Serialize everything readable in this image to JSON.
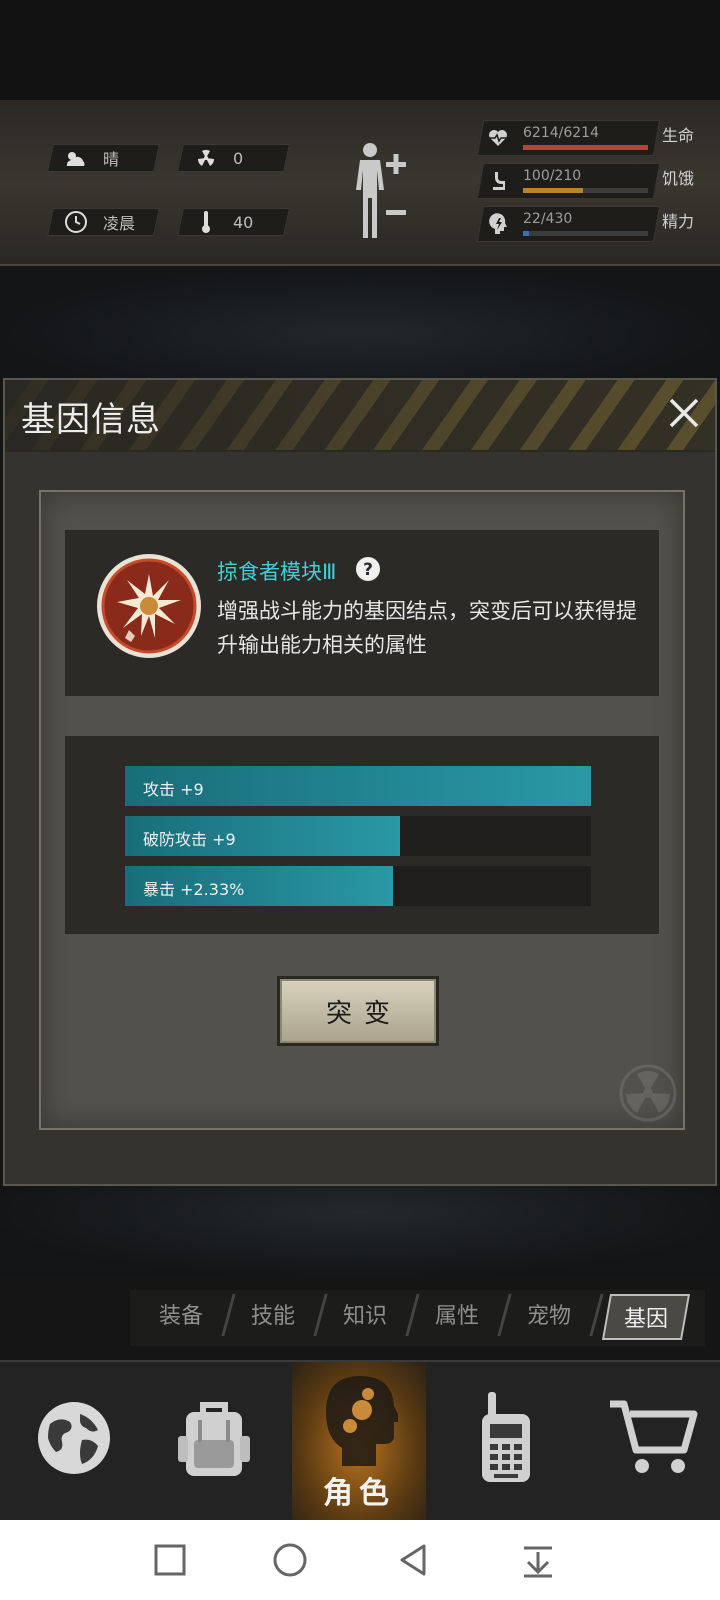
{
  "status": {
    "weather": "晴",
    "radiation": "0",
    "time_of_day": "凌晨",
    "temperature": "40",
    "body_icon": "body-plus-minus-icon",
    "vitals": [
      {
        "value": "6214/6214",
        "label": "生命",
        "color": "#b8433a",
        "ratio": 1.0,
        "icon": "heart-pulse-icon"
      },
      {
        "value": "100/210",
        "label": "饥饿",
        "color": "#b8842a",
        "ratio": 0.476,
        "icon": "stomach-icon"
      },
      {
        "value": "22/430",
        "label": "精力",
        "color": "#3a6fb8",
        "ratio": 0.051,
        "icon": "head-energy-icon"
      }
    ]
  },
  "modal": {
    "title": "基因信息",
    "gene": {
      "name": "掠食者模块Ⅲ",
      "description": "增强战斗能力的基因结点，突变后可以获得提升输出能力相关的属性",
      "icon": "predator-gene-icon"
    },
    "attributes": [
      {
        "label": "攻击 +9",
        "ratio": 1.0
      },
      {
        "label": "破防攻击 +9",
        "ratio": 0.59
      },
      {
        "label": "暴击 +2.33%",
        "ratio": 0.575
      }
    ],
    "mutate_label": "突变"
  },
  "subtabs": [
    {
      "label": "装备",
      "active": false
    },
    {
      "label": "技能",
      "active": false
    },
    {
      "label": "知识",
      "active": false
    },
    {
      "label": "属性",
      "active": false
    },
    {
      "label": "宠物",
      "active": false
    },
    {
      "label": "基因",
      "active": true
    }
  ],
  "bottom_nav": [
    {
      "name": "globe-icon",
      "label": ""
    },
    {
      "name": "backpack-icon",
      "label": ""
    },
    {
      "name": "character-head-icon",
      "label": "角色",
      "active": true
    },
    {
      "name": "walkie-talkie-icon",
      "label": ""
    },
    {
      "name": "shopping-cart-icon",
      "label": ""
    }
  ],
  "colors": {
    "accent_cyan": "#3fcfd5",
    "bar_teal": "#2a98a6",
    "active_orange": "#b7721f"
  }
}
